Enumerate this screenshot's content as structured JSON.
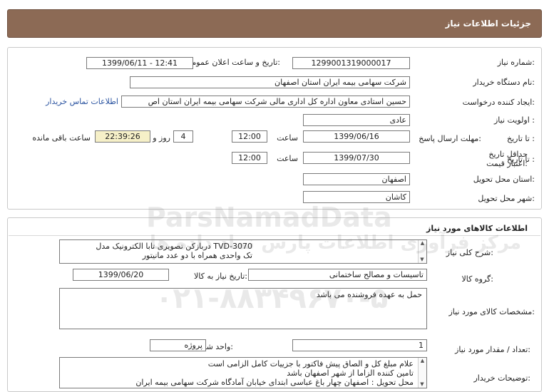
{
  "header": {
    "title": "جزئیات اطلاعات نیاز"
  },
  "info": {
    "need_number": {
      "label": "شماره نیاز:",
      "value": "1299001319000017"
    },
    "announce_datetime": {
      "label": "تاریخ و ساعت اعلان عمومی:",
      "value": "1399/06/11 - 12:41"
    },
    "buyer_org": {
      "label": "نام دستگاه خریدار:",
      "value": "شرکت سهامی بیمه ایران استان اصفهان"
    },
    "requester": {
      "label": "ایجاد کننده درخواست:",
      "value": "حسین استادی معاون اداره کل اداری مالی شرکت سهامی بیمه ایران استان اص"
    },
    "contact_link": "اطلاعات تماس خریدار",
    "priority": {
      "label": "اولویت نیاز :",
      "value": "عادی"
    },
    "response_deadline": {
      "label": "مهلت ارسال پاسخ:",
      "to_date_label": "تا تاریخ :",
      "date": "1399/06/16",
      "time_label": "ساعت",
      "time": "12:00",
      "days": "4",
      "days_label": "روز و",
      "remaining_time": "22:39:26",
      "remaining_label": "ساعت باقی مانده"
    },
    "price_validity": {
      "label": "حداقل تاریخ اعتبار قیمت:",
      "to_date_label": "تا تاریخ :",
      "date": "1399/07/30",
      "time_label": "ساعت",
      "time": "12:00"
    },
    "province": {
      "label": "استان محل تحویل:",
      "value": "اصفهان"
    },
    "city": {
      "label": "شهر محل تحویل:",
      "value": "کاشان"
    }
  },
  "goods": {
    "section_title": "اطلاعات کالاهای مورد نیاز",
    "description": {
      "label": "شرح کلی نیاز:",
      "line1": "دربازکن تصویری تابا الکترونیک مدل TVD-3070",
      "line2": "تک واحدی همراه با دو عدد مانیتور"
    },
    "group": {
      "label": "گروه کالا:",
      "value": "تاسیسات و مصالح ساختمانی"
    },
    "need_date": {
      "label": "تاریخ نیاز به کالا:",
      "value": "1399/06/20"
    },
    "specs": {
      "label": "مشخصات کالای مورد نیاز:",
      "value": "حمل به عهده فروشنده می باشد"
    },
    "unit": {
      "label": "واحد شمارش:",
      "value": "پروژه"
    },
    "quantity": {
      "label": "تعداد / مقدار مورد نیاز:",
      "value": "1"
    },
    "buyer_notes": {
      "label": "توضیحات خریدار:",
      "line1": "علام مبلغ کل و الصاق پیش فاکتور با جزییات کامل الزامی است",
      "line2": "تامین کننده الزاما از شهر اصفهان باشد",
      "line3": "محل تحویل : اصفهان چهار باغ عباسی ابتدای خیابان آمادگاه شرکت سهامی بیمه ایران"
    }
  },
  "watermark": {
    "brand": "ParsNamadData",
    "persian": "مرکز فرآوری اطلاعات پارس نماد داده ها",
    "phone": "۰۲۱-۸۸۳۴۹۶۷۰-۵"
  }
}
